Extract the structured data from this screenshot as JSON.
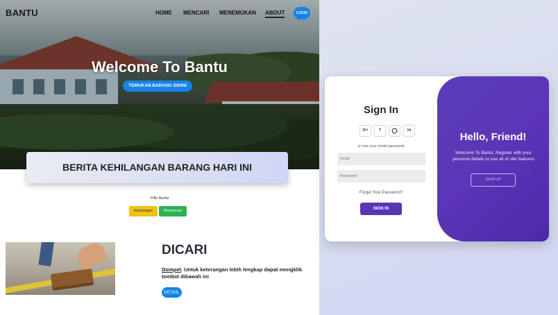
{
  "nav": {
    "brand": "BANTU",
    "links": [
      "HOME",
      "MENCARI",
      "MENEMUKAN",
      "ABOUT"
    ],
    "login": "LOGIN"
  },
  "hero": {
    "title": "Welcome To Bantu",
    "cta": "TEMUKAN BARANG DISINI"
  },
  "news": {
    "banner": "BERITA KEHILANGAN BARANG HARI INI",
    "pick_label": "Pilih Berita",
    "tabs": [
      "Kehilangan",
      "Penemuan"
    ]
  },
  "listing": {
    "title": "DICARI",
    "item": "Dompet",
    "desc": ". Untuk keterangan lebih lengkap dapat mengklik tombol dibawah ini",
    "detail": "DETAIL"
  },
  "signin": {
    "title": "Sign In",
    "social": [
      "G+",
      "f",
      "gh",
      "in"
    ],
    "or_text": "or use your email password",
    "email_placeholder": "Email",
    "password_placeholder": "Password",
    "forgot": "Forget Your Password?",
    "button": "SIGN IN"
  },
  "signup_panel": {
    "title": "Hello, Friend!",
    "text": "Welcome To Bantu, Register with your personal details to use all of site features",
    "button": "SIGN UP"
  },
  "colors": {
    "primary_blue": "#1683e8",
    "purple": "#5a34b6",
    "yellow": "#f0c21b",
    "green": "#2eb153"
  }
}
